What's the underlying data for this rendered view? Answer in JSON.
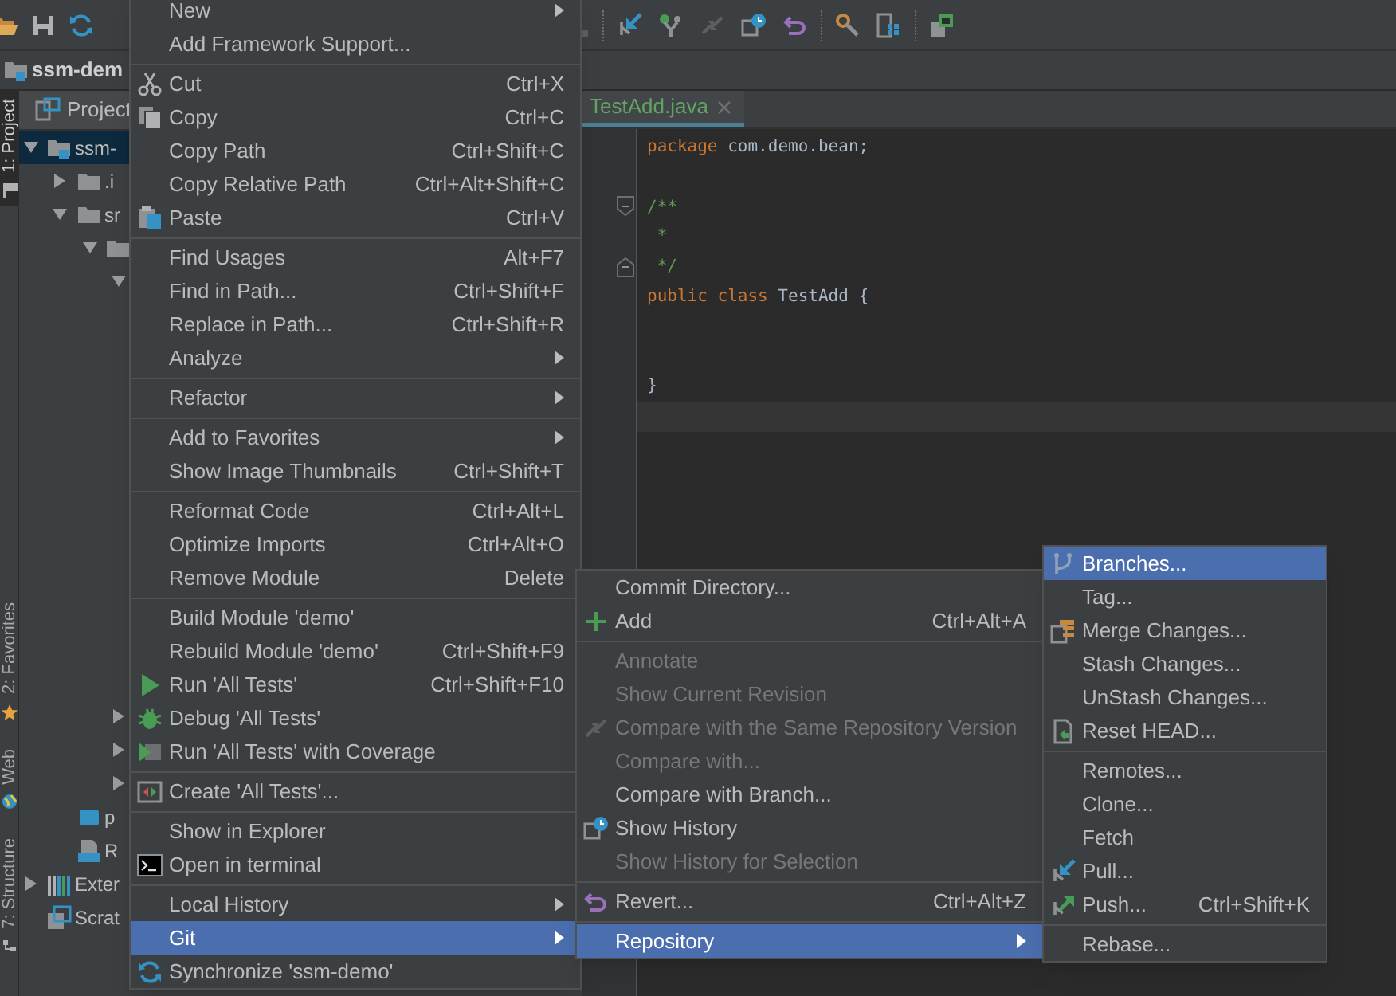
{
  "project_bar": {
    "title": "ssm-dem"
  },
  "tool_windows": [
    {
      "label": "1: Project",
      "selected": true
    },
    {
      "label": "2: Favorites",
      "selected": false
    },
    {
      "label": "Web",
      "selected": false
    },
    {
      "label": "7: Structure",
      "selected": false
    }
  ],
  "project_panel": {
    "title": "Project",
    "tree": [
      {
        "label": "ssm-",
        "kind": "module",
        "expanded": true,
        "selected": true,
        "children": [
          {
            "label": ".i",
            "kind": "folder",
            "expanded": false,
            "selected": false
          },
          {
            "label": "sr",
            "kind": "folder",
            "expanded": true,
            "selected": false,
            "children": [
              {
                "kind": "folder",
                "expanded": true,
                "selected": false,
                "children": [
                  {
                    "expanded": true,
                    "selected": false
                  },
                  {
                    "expanded": false,
                    "selected": false
                  },
                  {
                    "expanded": false,
                    "selected": false
                  },
                  {
                    "expanded": false,
                    "selected": false
                  }
                ]
              }
            ]
          },
          {
            "label": "p",
            "kind": "maven",
            "selected": false
          },
          {
            "label": "R",
            "kind": "markdown",
            "selected": false
          }
        ]
      },
      {
        "label": "Exter",
        "kind": "libraries",
        "expanded": false,
        "selected": false
      },
      {
        "label": "Scrat",
        "kind": "scratches",
        "selected": false
      }
    ]
  },
  "editor": {
    "tabs": [
      {
        "label": "TestAdd.java",
        "selected": true
      }
    ],
    "code": [
      {
        "text": "package",
        "kind": "keyword"
      },
      {
        "text": " com.demo.bean;\n\n",
        "kind": "plain"
      },
      {
        "text": "/**\n *\n */\n",
        "kind": "doc",
        "expanded": true
      },
      {
        "text": "public class",
        "kind": "keyword"
      },
      {
        "text": " TestAdd {\n\n\n}",
        "kind": "plain"
      }
    ],
    "current_line_highlight": true
  },
  "context_menu": {
    "groups": [
      [
        {
          "label": "New",
          "kind": "plain",
          "submenu": true,
          "selected": false
        },
        {
          "label": "Add Framework Support...",
          "kind": "plain",
          "submenu": false,
          "selected": false
        }
      ],
      [
        {
          "label": "Cut",
          "kind": "cut",
          "shortcut": "Ctrl+X",
          "submenu": false,
          "selected": false
        },
        {
          "label": "Copy",
          "kind": "copy",
          "shortcut": "Ctrl+C",
          "submenu": false,
          "selected": false
        },
        {
          "label": "Copy Path",
          "kind": "plain",
          "shortcut": "Ctrl+Shift+C",
          "submenu": false,
          "selected": false
        },
        {
          "label": "Copy Relative Path",
          "kind": "plain",
          "shortcut": "Ctrl+Alt+Shift+C",
          "submenu": false,
          "selected": false
        },
        {
          "label": "Paste",
          "kind": "paste",
          "shortcut": "Ctrl+V",
          "submenu": false,
          "selected": false
        }
      ],
      [
        {
          "label": "Find Usages",
          "kind": "plain",
          "shortcut": "Alt+F7",
          "submenu": false,
          "selected": false
        },
        {
          "label": "Find in Path...",
          "kind": "plain",
          "shortcut": "Ctrl+Shift+F",
          "submenu": false,
          "selected": false
        },
        {
          "label": "Replace in Path...",
          "kind": "plain",
          "shortcut": "Ctrl+Shift+R",
          "submenu": false,
          "selected": false
        },
        {
          "label": "Analyze",
          "kind": "plain",
          "submenu": true,
          "selected": false
        }
      ],
      [
        {
          "label": "Refactor",
          "kind": "plain",
          "submenu": true,
          "selected": false
        }
      ],
      [
        {
          "label": "Add to Favorites",
          "kind": "plain",
          "submenu": true,
          "selected": false
        },
        {
          "label": "Show Image Thumbnails",
          "kind": "plain",
          "shortcut": "Ctrl+Shift+T",
          "submenu": false,
          "selected": false
        }
      ],
      [
        {
          "label": "Reformat Code",
          "kind": "plain",
          "shortcut": "Ctrl+Alt+L",
          "submenu": false,
          "selected": false
        },
        {
          "label": "Optimize Imports",
          "kind": "plain",
          "shortcut": "Ctrl+Alt+O",
          "submenu": false,
          "selected": false
        },
        {
          "label": "Remove Module",
          "kind": "plain",
          "shortcut": "Delete",
          "submenu": false,
          "selected": false
        }
      ],
      [
        {
          "label": "Build Module 'demo'",
          "kind": "plain",
          "submenu": false,
          "selected": false
        },
        {
          "label": "Rebuild Module 'demo'",
          "kind": "plain",
          "shortcut": "Ctrl+Shift+F9",
          "submenu": false,
          "selected": false
        },
        {
          "label": "Run 'All Tests'",
          "kind": "run",
          "shortcut": "Ctrl+Shift+F10",
          "submenu": false,
          "selected": false
        },
        {
          "label": "Debug 'All Tests'",
          "kind": "debug",
          "submenu": false,
          "selected": false
        },
        {
          "label": "Run 'All Tests' with Coverage",
          "kind": "coverage",
          "submenu": false,
          "selected": false
        }
      ],
      [
        {
          "label": "Create 'All Tests'...",
          "kind": "test",
          "submenu": false,
          "selected": false
        }
      ],
      [
        {
          "label": "Show in Explorer",
          "kind": "plain",
          "submenu": false,
          "selected": false
        },
        {
          "label": "Open in terminal",
          "kind": "terminal",
          "submenu": false,
          "selected": false
        }
      ],
      [
        {
          "label": "Local History",
          "kind": "plain",
          "submenu": true,
          "selected": false
        },
        {
          "label": "Git",
          "kind": "plain",
          "submenu": true,
          "selected": true
        },
        {
          "label": "Synchronize 'ssm-demo'",
          "kind": "sync",
          "submenu": false,
          "selected": false
        }
      ]
    ]
  },
  "git_menu": {
    "groups": [
      [
        {
          "label": "Commit Directory...",
          "kind": "plain",
          "submenu": false,
          "disabled": false,
          "selected": false
        },
        {
          "label": "Add",
          "kind": "add",
          "shortcut": "Ctrl+Alt+A",
          "submenu": false,
          "disabled": false,
          "selected": false
        }
      ],
      [
        {
          "label": "Annotate",
          "kind": "plain",
          "submenu": false,
          "disabled": true,
          "selected": false
        },
        {
          "label": "Show Current Revision",
          "kind": "plain",
          "submenu": false,
          "disabled": true,
          "selected": false
        },
        {
          "label": "Compare with the Same Repository Version",
          "kind": "compare",
          "submenu": false,
          "disabled": true,
          "selected": false
        },
        {
          "label": "Compare with...",
          "kind": "plain",
          "submenu": false,
          "disabled": true,
          "selected": false
        },
        {
          "label": "Compare with Branch...",
          "kind": "plain",
          "submenu": false,
          "disabled": false,
          "selected": false
        },
        {
          "label": "Show History",
          "kind": "history",
          "submenu": false,
          "disabled": false,
          "selected": false
        },
        {
          "label": "Show History for Selection",
          "kind": "plain",
          "submenu": false,
          "disabled": true,
          "selected": false
        }
      ],
      [
        {
          "label": "Revert...",
          "kind": "revert",
          "shortcut": "Ctrl+Alt+Z",
          "submenu": false,
          "disabled": false,
          "selected": false
        }
      ],
      [
        {
          "label": "Repository",
          "kind": "plain",
          "submenu": true,
          "disabled": false,
          "selected": true
        }
      ]
    ]
  },
  "repository_menu": {
    "groups": [
      [
        {
          "label": "Branches...",
          "kind": "branches",
          "selected": true
        },
        {
          "label": "Tag...",
          "kind": "plain",
          "selected": false
        },
        {
          "label": "Merge Changes...",
          "kind": "merge",
          "selected": false
        },
        {
          "label": "Stash Changes...",
          "kind": "plain",
          "selected": false
        },
        {
          "label": "UnStash Changes...",
          "kind": "plain",
          "selected": false
        },
        {
          "label": "Reset HEAD...",
          "kind": "reset",
          "selected": false
        }
      ],
      [
        {
          "label": "Remotes...",
          "kind": "plain",
          "selected": false
        },
        {
          "label": "Clone...",
          "kind": "plain",
          "selected": false
        },
        {
          "label": "Fetch",
          "kind": "plain",
          "selected": false
        },
        {
          "label": "Pull...",
          "kind": "pull",
          "selected": false
        },
        {
          "label": "Push...",
          "kind": "push",
          "shortcut": "Ctrl+Shift+K",
          "selected": false
        }
      ],
      [
        {
          "label": "Rebase...",
          "kind": "plain",
          "selected": false
        }
      ]
    ]
  }
}
